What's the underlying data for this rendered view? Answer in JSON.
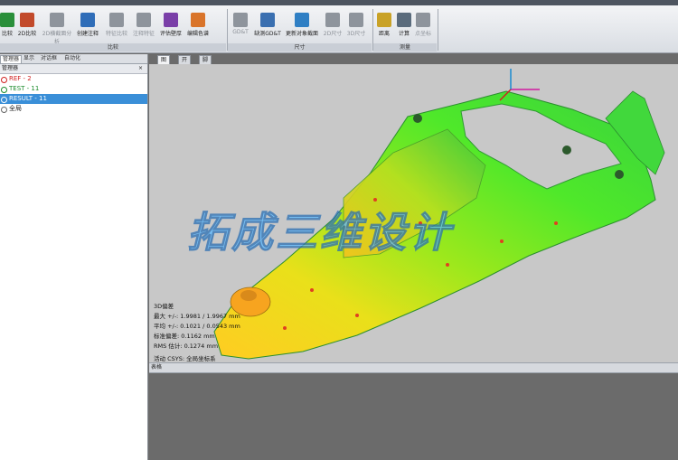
{
  "ribbon": {
    "tools": [
      {
        "label": "比较",
        "color": "#2a8f3a",
        "disabled": false
      },
      {
        "label": "2D比较",
        "color": "#c24a2b",
        "disabled": false
      },
      {
        "label": "2D横截面分析",
        "color": "#8e949c",
        "disabled": true
      },
      {
        "label": "创建注释",
        "color": "#2f6db8",
        "disabled": false
      },
      {
        "label": "特征比较",
        "color": "#8e949c",
        "disabled": true
      },
      {
        "label": "注释特征",
        "color": "#8e949c",
        "disabled": true
      },
      {
        "label": "评估壁厚",
        "color": "#7a3fa8",
        "disabled": false
      },
      {
        "label": "编辑色谱",
        "color": "#d9742a",
        "disabled": false
      },
      {
        "label": "GD&T",
        "color": "#8e949c",
        "disabled": true
      },
      {
        "label": "缺测GD&T",
        "color": "#3a6fb0",
        "disabled": false
      },
      {
        "label": "更新对象截面",
        "color": "#2f7fc4",
        "disabled": false
      },
      {
        "label": "2D尺寸",
        "color": "#8e949c",
        "disabled": true
      },
      {
        "label": "3D尺寸",
        "color": "#8e949c",
        "disabled": true
      },
      {
        "label": "距离",
        "color": "#c9a227",
        "disabled": false
      },
      {
        "label": "计算",
        "color": "#5a6b7c",
        "disabled": false
      },
      {
        "label": "点坐标",
        "color": "#8e949c",
        "disabled": true
      }
    ],
    "groups": [
      "比较",
      "尺寸",
      "测量"
    ]
  },
  "left_panel": {
    "tabs": [
      "管理器",
      "显示",
      "对话框",
      "自动化"
    ],
    "title": "管理器",
    "close_glyph": "× ",
    "items": [
      {
        "label": "REF - 2",
        "color": "#d02020"
      },
      {
        "label": "TEST - 11",
        "color": "#1a8a2a"
      },
      {
        "label": "RESULT - 11",
        "color": "#ffffff"
      },
      {
        "label": "全局",
        "color": "#222222"
      }
    ]
  },
  "view_tabs": [
    "图形",
    "开始",
    "脚本"
  ],
  "viewport": {
    "watermark": "拓成三维设计",
    "overlay": {
      "title": "3D偏差",
      "max": "最大 +/-: 1.9981 / 1.9967 mm",
      "mean": "平均 +/-: 0.1021 / 0.0543 mm",
      "std": "标准偏差: 0.1162 mm",
      "rms": "RMS 估计: 0.1274 mm",
      "active_csys": "活动 CSYS: 全局坐标系"
    }
  },
  "bottom_panel": {
    "title": "表格"
  }
}
